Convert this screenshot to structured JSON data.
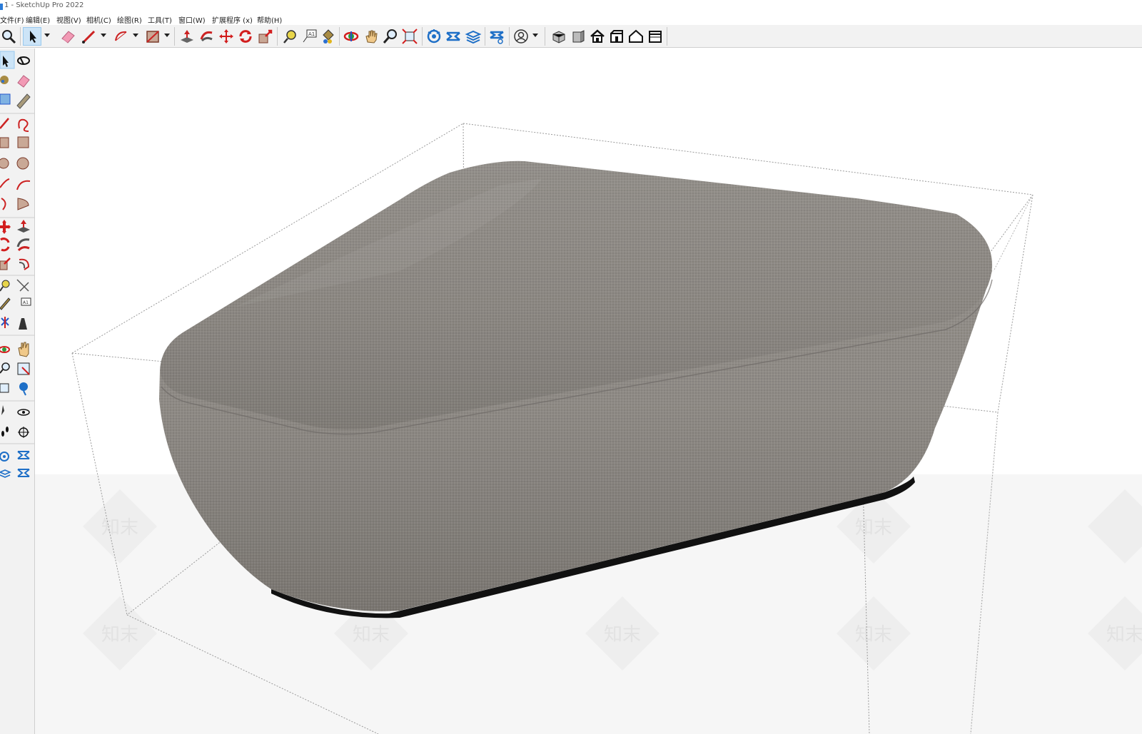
{
  "window": {
    "title": "1 - SketchUp Pro 2022"
  },
  "menu": [
    {
      "label": "文件(F)"
    },
    {
      "label": "编辑(E)"
    },
    {
      "label": "视图(V)"
    },
    {
      "label": "相机(C)"
    },
    {
      "label": "绘图(R)"
    },
    {
      "label": "工具(T)"
    },
    {
      "label": "窗口(W)"
    },
    {
      "label": "扩展程序 (x)"
    },
    {
      "label": "帮助(H)"
    }
  ],
  "toolbar": {
    "tools": [
      "zoom-icon",
      "select-icon",
      "eraser-icon",
      "line-icon",
      "arc-icon",
      "rectangle-icon",
      "push-pull-icon",
      "follow-me-icon",
      "move-icon",
      "rotate-icon",
      "scale-icon",
      "tape-measure-icon",
      "text-icon",
      "paint-bucket-icon",
      "orbit-icon",
      "pan-icon",
      "zoom-tool-icon",
      "zoom-extents-icon",
      "warehouse-icon",
      "sandbox-icon",
      "layers-icon",
      "styles-icon",
      "account-icon",
      "iso-view-icon",
      "front-view-icon",
      "top-view-icon",
      "right-view-icon",
      "back-view-icon",
      "left-view-icon"
    ]
  },
  "left_toolbar": {
    "tools": [
      "select-icon",
      "orbit-icon",
      "paint-bucket-icon",
      "eraser-icon",
      "component-icon",
      "tag-icon",
      "line-icon",
      "freehand-icon",
      "rectangle-icon",
      "rotated-rectangle-icon",
      "circle-icon",
      "polygon-icon",
      "arc-icon",
      "arc-2point-icon",
      "arc-3point-icon",
      "pie-icon",
      "move-icon",
      "push-pull-icon",
      "rotate-icon",
      "follow-me-icon",
      "scale-icon",
      "offset-icon",
      "tape-measure-icon",
      "dimension-icon",
      "protractor-icon",
      "text-icon",
      "axes-icon",
      "3d-text-icon",
      "orbit-2-icon",
      "pan-icon",
      "zoom-icon",
      "zoom-window-icon",
      "zoom-extents-icon",
      "previous-view-icon",
      "position-camera-icon",
      "look-around-icon",
      "walk-icon",
      "section-plane-icon",
      "warehouse-icon",
      "sandbox-icon",
      "layers-icon",
      "styles-icon"
    ]
  },
  "watermark": {
    "text": "知末"
  },
  "colors": {
    "fabric": "#8e8a85",
    "bounding_box": "#9a9a9a",
    "toolbar_bg": "#f2f2f2",
    "ground": "#f6f6f6"
  }
}
